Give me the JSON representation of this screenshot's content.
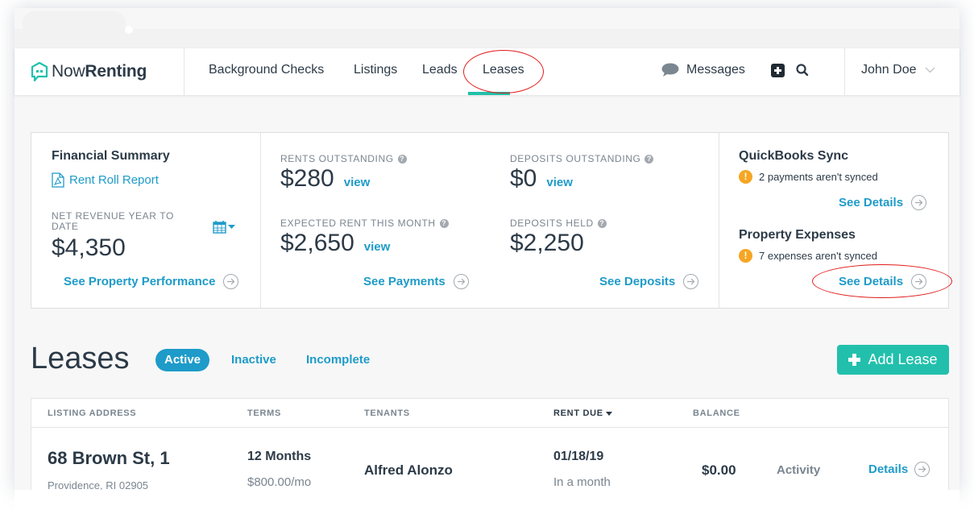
{
  "app": {
    "logo_part1": "Now",
    "logo_part2": "Renting"
  },
  "nav": {
    "items": [
      {
        "label": "Background Checks"
      },
      {
        "label": "Listings"
      },
      {
        "label": "Leads"
      },
      {
        "label": "Leases",
        "active": true
      }
    ],
    "messages_label": "Messages",
    "user_name": "John Doe"
  },
  "summary": {
    "financial": {
      "title": "Financial Summary",
      "report_link": "Rent Roll Report",
      "net_revenue_label": "NET REVENUE YEAR TO DATE",
      "net_revenue_value": "$4,350",
      "performance_link": "See Property Performance"
    },
    "rents_outstanding": {
      "label": "RENTS OUTSTANDING",
      "value": "$280",
      "view": "view"
    },
    "expected_rent": {
      "label": "EXPECTED RENT THIS MONTH",
      "value": "$2,650",
      "view": "view"
    },
    "payments_link": "See Payments",
    "deposits_outstanding": {
      "label": "DEPOSITS OUTSTANDING",
      "value": "$0",
      "view": "view"
    },
    "deposits_held": {
      "label": "DEPOSITS HELD",
      "value": "$2,250"
    },
    "deposits_link": "See Deposits",
    "quickbooks": {
      "title": "QuickBooks Sync",
      "warning": "2 payments aren't synced",
      "details_link": "See Details"
    },
    "expenses": {
      "title": "Property Expenses",
      "warning": "7 expenses aren't synced",
      "details_link": "See Details"
    }
  },
  "leases": {
    "title": "Leases",
    "filters": [
      {
        "label": "Active",
        "active": true
      },
      {
        "label": "Inactive"
      },
      {
        "label": "Incomplete"
      }
    ],
    "add_button": "Add Lease",
    "columns": [
      "LISTING ADDRESS",
      "TERMS",
      "TENANTS",
      "RENT DUE",
      "BALANCE"
    ],
    "sorted_column": "RENT DUE",
    "rows": [
      {
        "address": "68 Brown St, 1",
        "city": "Providence, RI 02905",
        "term": "12 Months",
        "rent": "$800.00/mo",
        "tenant": "Alfred Alonzo",
        "rent_due": "01/18/19",
        "rent_due_relative": "In a month",
        "balance": "$0.00",
        "activity": "Activity",
        "details": "Details"
      }
    ]
  },
  "colors": {
    "accent_blue": "#1e9bc9",
    "accent_teal": "#22c0ac",
    "warning_orange": "#f5a623",
    "annotation_red": "#e11a1a"
  }
}
